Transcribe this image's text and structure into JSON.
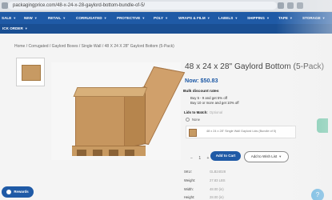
{
  "browser": {
    "url": "packagingprice.com/48-x-24-x-28-gaylord-bottom-bundle-of-5/"
  },
  "nav": {
    "items": [
      {
        "label": "SALE"
      },
      {
        "label": "NEW"
      },
      {
        "label": "RETAIL"
      },
      {
        "label": "CORRUGATED"
      },
      {
        "label": "PROTECTIVE"
      },
      {
        "label": "POLY"
      },
      {
        "label": "WRAPS & FILM"
      },
      {
        "label": "LABELS"
      },
      {
        "label": "SHIPPING"
      },
      {
        "label": "TAPE"
      },
      {
        "label": "STORAGE"
      }
    ],
    "subnav_label": "ICK ORDER"
  },
  "breadcrumb": "Home / Corrugated / Gaylord Boxes / Single Wall / 48 X 24 X 28\" Gaylord Bottom (5-Pack)",
  "product": {
    "title": "48 x 24 x 28\" Gaylord Bottom (5-Pack)",
    "price": "Now: $50.83",
    "discount_title": "Bulk discount rates",
    "discount_lines": [
      "Buy 5 - 9 and get 5% off",
      "Buy 10 or more and get 10% off"
    ],
    "lists_label": "Lids to Match:",
    "lists_optional": "Optional",
    "none_option": "None",
    "bundle_text": "48 x 24 x 28\" Single Wall Gaylord Lids (Bundle of 5)",
    "qty_display": "1",
    "add_to_cart": "Add to Cart",
    "add_to_wishlist": "Add to Wish List",
    "specs": [
      {
        "label": "SKU:",
        "value": "GLB24028"
      },
      {
        "label": "Weight:",
        "value": "27.83 LBS"
      },
      {
        "label": "Width:",
        "value": "48.00 (in)"
      },
      {
        "label": "Height:",
        "value": "28.00 (in)"
      }
    ]
  },
  "rewards": {
    "label": "Rewards"
  },
  "help": {
    "icon_label": "?"
  },
  "colors": {
    "brand_blue": "#1f5aa6",
    "accent_green": "#6bc6a7",
    "help_blue": "#5fb2e2"
  }
}
